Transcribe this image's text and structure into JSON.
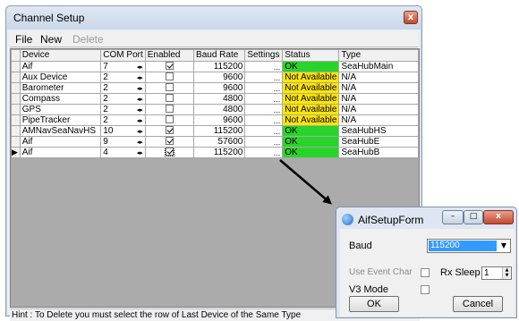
{
  "main_window": {
    "title": "Channel Setup",
    "close_glyph": "x",
    "menu": {
      "file": "File",
      "new": "New",
      "delete": "Delete"
    },
    "columns": [
      "Device",
      "COM Port",
      "Enabled",
      "Baud Rate",
      "Settings",
      "Status",
      "Type"
    ],
    "rows": [
      {
        "device": "Aif",
        "com": "7",
        "enabled": true,
        "baud": "115200",
        "status": "OK",
        "status_kind": "ok",
        "type": "SeaHubMain",
        "current": false
      },
      {
        "device": "Aux Device",
        "com": "2",
        "enabled": false,
        "baud": "9600",
        "status": "Not Available",
        "status_kind": "na",
        "type": "N/A",
        "current": false
      },
      {
        "device": "Barometer",
        "com": "2",
        "enabled": false,
        "baud": "9600",
        "status": "Not Available",
        "status_kind": "na",
        "type": "N/A",
        "current": false
      },
      {
        "device": "Compass",
        "com": "2",
        "enabled": false,
        "baud": "4800",
        "status": "Not Available",
        "status_kind": "na",
        "type": "N/A",
        "current": false
      },
      {
        "device": "GPS",
        "com": "2",
        "enabled": false,
        "baud": "4800",
        "status": "Not Available",
        "status_kind": "na",
        "type": "N/A",
        "current": false
      },
      {
        "device": "PipeTracker",
        "com": "2",
        "enabled": false,
        "baud": "9600",
        "status": "Not Available",
        "status_kind": "na",
        "type": "N/A",
        "current": false
      },
      {
        "device": "AMNavSeaNavHS",
        "com": "10",
        "enabled": true,
        "baud": "115200",
        "status": "OK",
        "status_kind": "ok",
        "type": "SeaHubHS",
        "current": false
      },
      {
        "device": "Aif",
        "com": "9",
        "enabled": true,
        "baud": "57600",
        "status": "OK",
        "status_kind": "ok",
        "type": "SeaHubE",
        "current": false
      },
      {
        "device": "Aif",
        "com": "4",
        "enabled": true,
        "baud": "115200",
        "status": "OK",
        "status_kind": "ok",
        "type": "SeaHubB",
        "current": true
      }
    ],
    "settings_glyph": "...",
    "spinner_glyph": "◂▸",
    "current_row_glyph": "▶",
    "hint": "Hint : To Delete you must select the row of Last Device of the Same Type"
  },
  "dialog": {
    "title": "AifSetupForm",
    "baud_label": "Baud",
    "baud_value": "115200",
    "use_event_char_label": "Use Event Char",
    "rx_sleep_label": "Rx Sleep",
    "rx_sleep_value": "1",
    "v3_mode_label": "V3 Mode",
    "ok_label": "OK",
    "cancel_label": "Cancel",
    "minimize_glyph": "–",
    "maximize_glyph": "□",
    "close_glyph": "x",
    "dropdown_glyph": "▼",
    "spin_up_glyph": "▲",
    "spin_down_glyph": "▼"
  },
  "colors": {
    "status_ok": "#29d42a",
    "status_na": "#ffe600",
    "selection": "#3399ff"
  }
}
